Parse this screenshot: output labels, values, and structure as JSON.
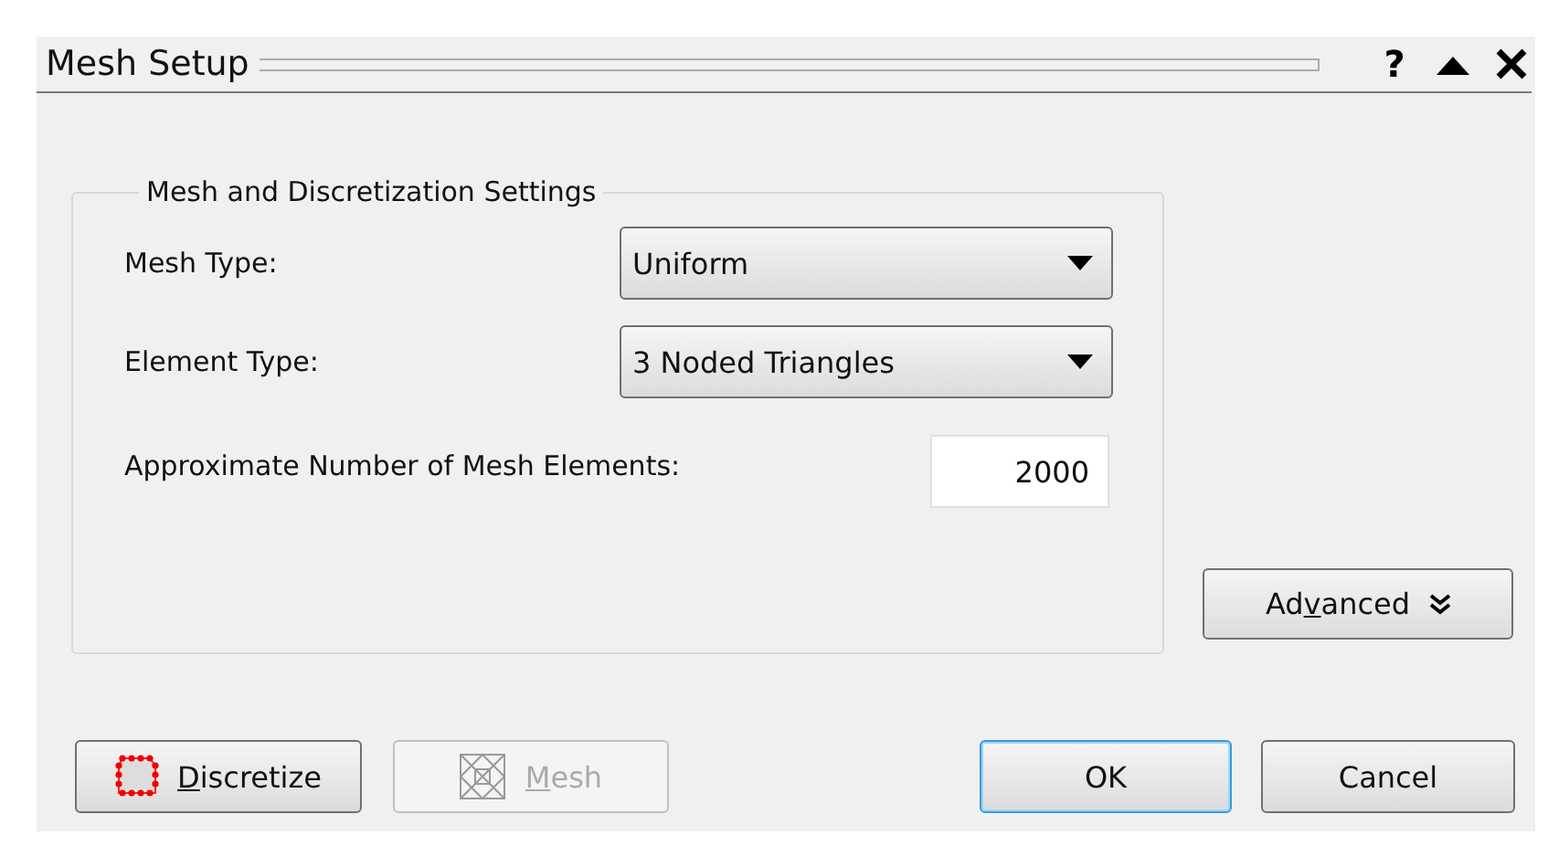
{
  "window": {
    "title": "Mesh Setup",
    "controls": [
      {
        "kind": "help",
        "label": "?"
      },
      {
        "kind": "collapse"
      },
      {
        "kind": "close"
      }
    ]
  },
  "group": {
    "title": "Mesh and Discretization Settings",
    "fields": [
      {
        "kind": "combo",
        "label": "Mesh Type:",
        "value": "Uniform"
      },
      {
        "kind": "combo",
        "label": "Element Type:",
        "value": "3 Noded Triangles"
      },
      {
        "kind": "number",
        "label": "Approximate Number of Mesh Elements:",
        "value": "2000"
      }
    ]
  },
  "advanced_button": {
    "pre": "Ad",
    "key": "v",
    "post": "anced"
  },
  "buttons": [
    {
      "kind": "discretize",
      "key": "D",
      "post": "iscretize",
      "disabled": false,
      "default": false
    },
    {
      "kind": "mesh",
      "key": "M",
      "post": "esh",
      "disabled": true,
      "default": false
    },
    {
      "kind": "plain",
      "post": "OK",
      "disabled": false,
      "default": true
    },
    {
      "kind": "plain",
      "post": "Cancel",
      "disabled": false,
      "default": false
    }
  ]
}
